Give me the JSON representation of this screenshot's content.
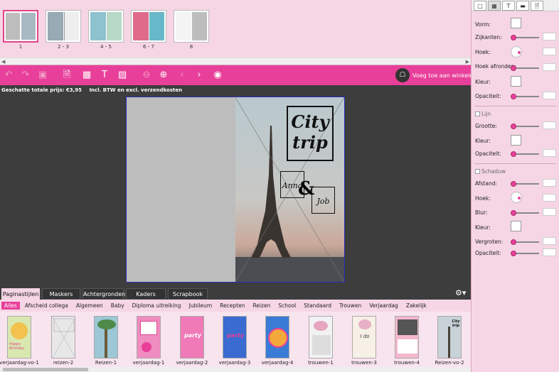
{
  "thumbnails": [
    {
      "label": "1",
      "selected": true
    },
    {
      "label": "2 - 3",
      "selected": false
    },
    {
      "label": "4 - 5",
      "selected": false
    },
    {
      "label": "6 - 7",
      "selected": false
    },
    {
      "label": "8",
      "selected": false
    }
  ],
  "toolbar": {
    "undo_icon": "undo-icon",
    "redo_icon": "redo-icon",
    "save_icon": "save-icon",
    "cart_label": "Voeg toe aan winkelmandje"
  },
  "price": {
    "label": "Geschatte totale prijs: €3,95",
    "note": "Incl. BTW en excl. verzendkosten"
  },
  "design": {
    "title_line1": "City",
    "title_line2": "trip",
    "name1": "Anna",
    "ampersand": "&",
    "name2": "Job"
  },
  "tabs": [
    {
      "label": "Paginastijlen",
      "active": true
    },
    {
      "label": "Maskers",
      "active": false
    },
    {
      "label": "Achtergronden",
      "active": false
    },
    {
      "label": "Kaders",
      "active": false
    },
    {
      "label": "Scrapbook",
      "active": false
    }
  ],
  "categories": [
    {
      "label": "Alles",
      "active": true
    },
    {
      "label": "Afscheid collega",
      "active": false
    },
    {
      "label": "Algemeen",
      "active": false
    },
    {
      "label": "Baby",
      "active": false
    },
    {
      "label": "Diploma uitreiking",
      "active": false
    },
    {
      "label": "Jubileum",
      "active": false
    },
    {
      "label": "Recepten",
      "active": false
    },
    {
      "label": "Reizen",
      "active": false
    },
    {
      "label": "School",
      "active": false
    },
    {
      "label": "Standaard",
      "active": false
    },
    {
      "label": "Trouwen",
      "active": false
    },
    {
      "label": "Verjaardag",
      "active": false
    },
    {
      "label": "Zakelijk",
      "active": false
    }
  ],
  "templates": [
    {
      "label": "verjaardag-vo-1",
      "text": "Happy Birthday",
      "color": "#d9e8b0"
    },
    {
      "label": "reizen-2",
      "text": "",
      "color": "#e8e8e8"
    },
    {
      "label": "Reizen-1",
      "text": "",
      "color": "#9cc7d6"
    },
    {
      "label": "verjaardag-1",
      "text": "",
      "color": "#f08cc0"
    },
    {
      "label": "verjaardag-2",
      "text": "party",
      "color": "#f07ab8"
    },
    {
      "label": "verjaardag-3",
      "text": "party",
      "color": "#3a6bd0"
    },
    {
      "label": "verjaardag-4",
      "text": "",
      "color": "#3a7bd6"
    },
    {
      "label": "trouwen-1",
      "text": "",
      "color": "#f2f2f2"
    },
    {
      "label": "trouwen-3",
      "text": "I do",
      "color": "#f7f0e6"
    },
    {
      "label": "trouwen-4",
      "text": "",
      "color": "#f4b8cc"
    },
    {
      "label": "Reizen-vo-2",
      "text": "City trip",
      "color": "#c8d2d8"
    }
  ],
  "props": {
    "vorm": "Vorm:",
    "zijkanten": "Zijkanten:",
    "hoek": "Hoek:",
    "hoek_afronden": "Hoek afronden:",
    "kleur": "Kleur:",
    "opaciteit": "Opaciteit:",
    "lijn": "Lijn",
    "grootte": "Grootte:",
    "kleur2": "Kleur:",
    "opaciteit2": "Opaciteit:",
    "schaduw": "Schaduw",
    "afstand": "Afstand:",
    "hoek2": "Hoek:",
    "blur": "Blur:",
    "kleur3": "Kleur:",
    "vergroten": "Vergroten:",
    "opaciteit3": "Opaciteit:"
  },
  "colors": {
    "accent": "#e8409a",
    "panel": "#f6d6e4",
    "workspace": "#3d3d3d"
  }
}
